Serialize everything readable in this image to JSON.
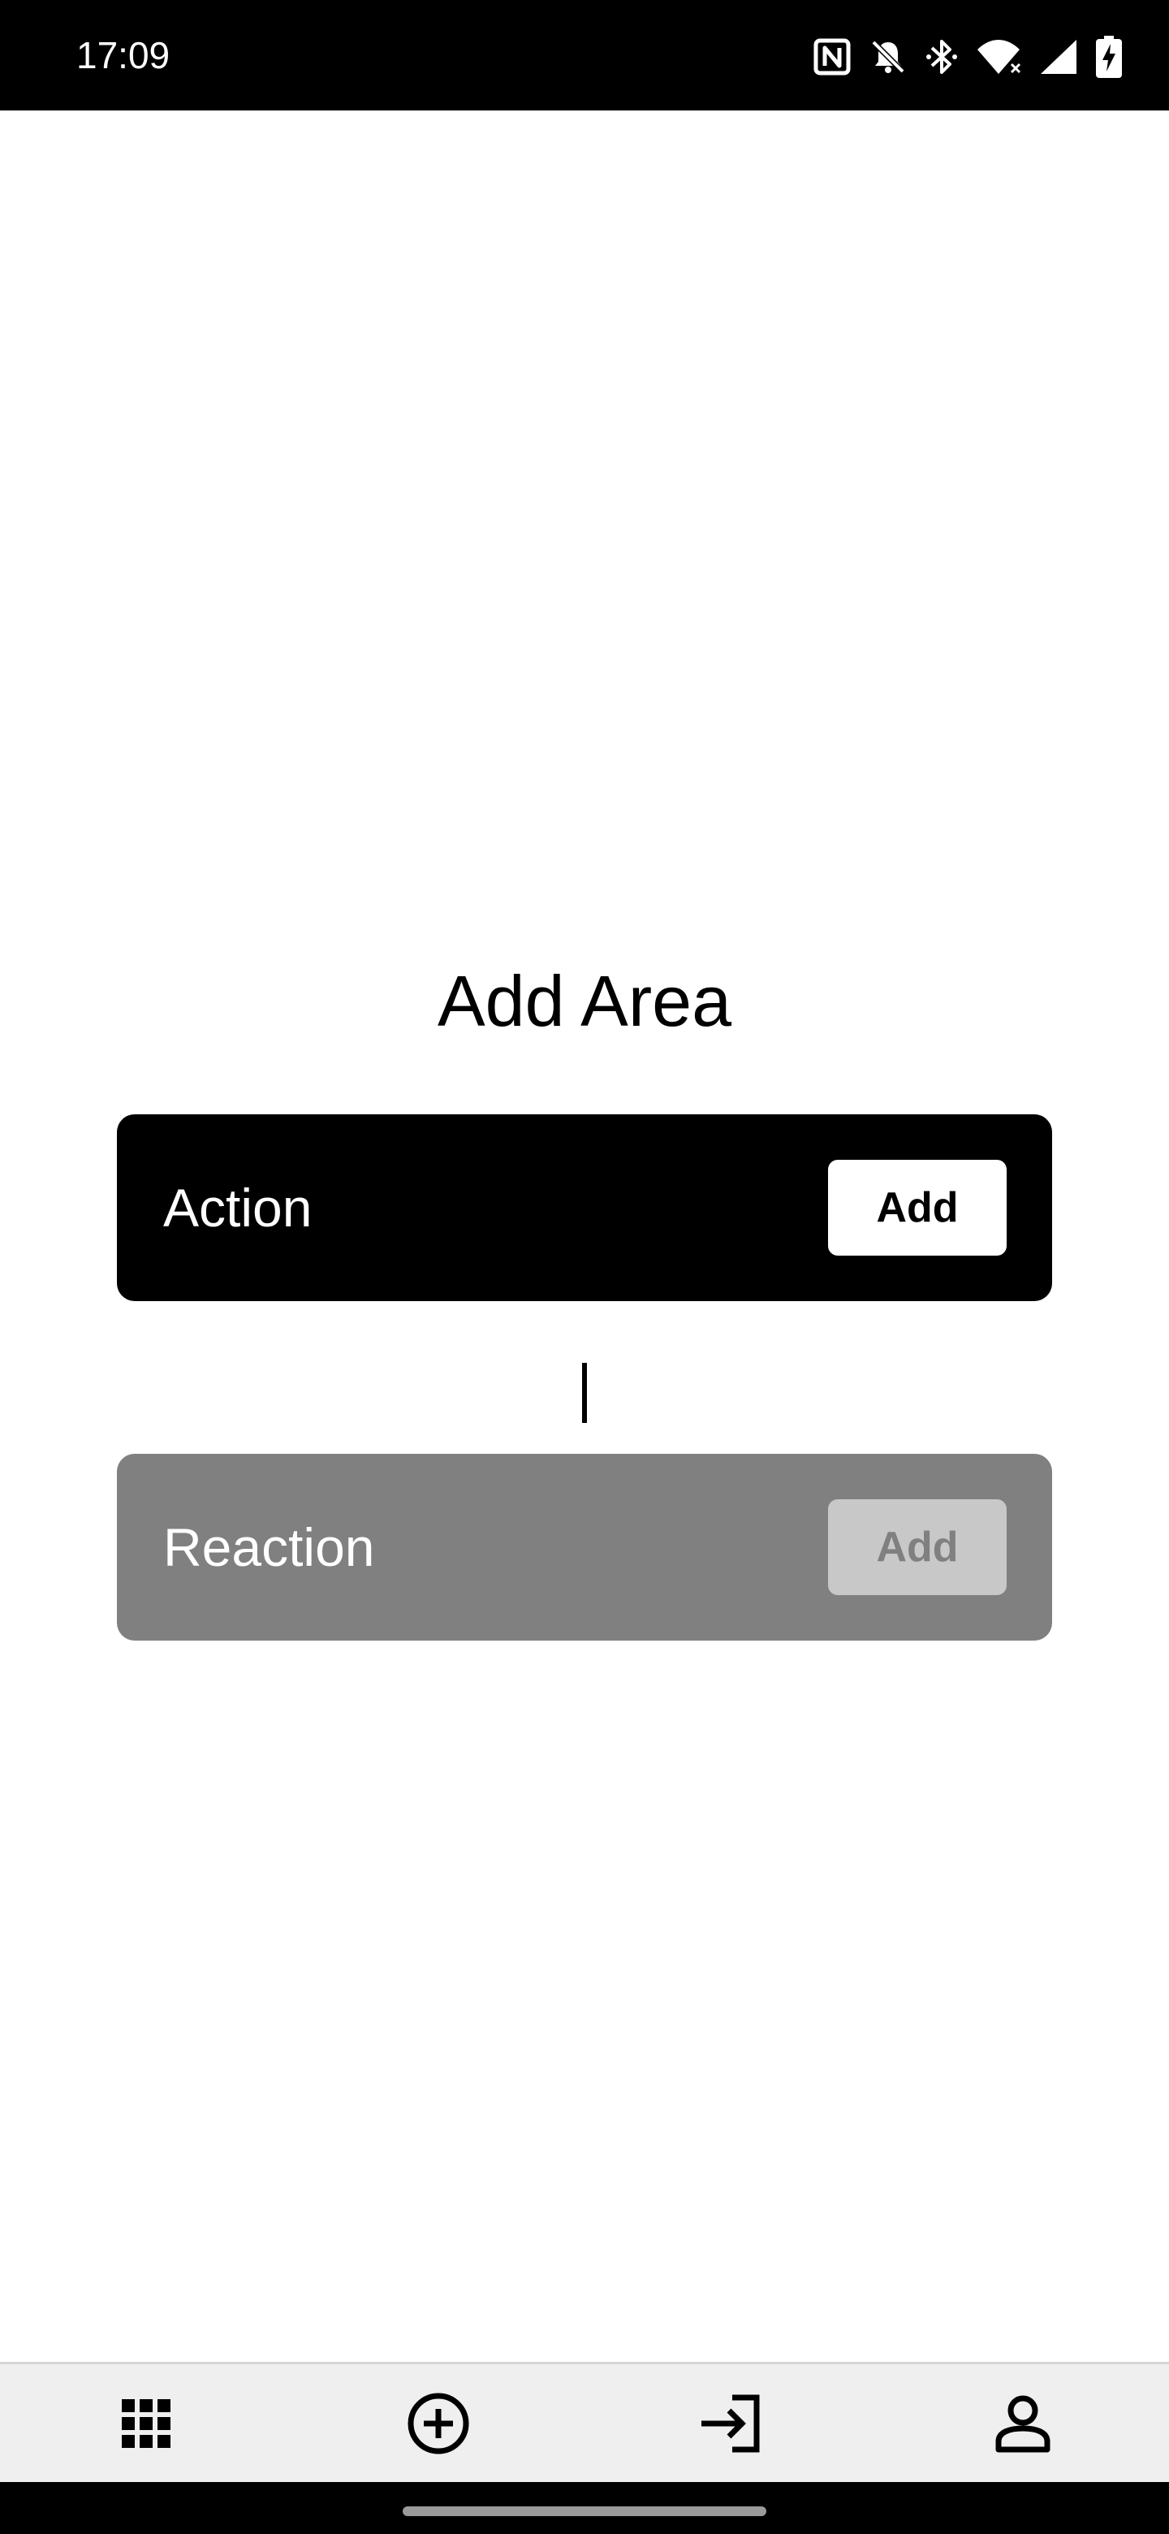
{
  "status_bar": {
    "time": "17:09",
    "icons": [
      "nfc-icon",
      "notifications-off-icon",
      "bluetooth-icon",
      "wifi-icon",
      "signal-icon",
      "battery-charging-icon"
    ]
  },
  "main": {
    "title": "Add Area",
    "action": {
      "label": "Action",
      "button_label": "Add",
      "enabled": true
    },
    "reaction": {
      "label": "Reaction",
      "button_label": "Add",
      "enabled": false
    }
  },
  "bottom_nav": {
    "items": [
      {
        "icon": "apps-grid-icon"
      },
      {
        "icon": "add-circle-icon"
      },
      {
        "icon": "login-icon"
      },
      {
        "icon": "person-icon"
      }
    ]
  },
  "colors": {
    "action_card": "#000000",
    "reaction_card": "#808080",
    "disabled_button": "#c8c8c8",
    "nav_background": "#efefef"
  }
}
